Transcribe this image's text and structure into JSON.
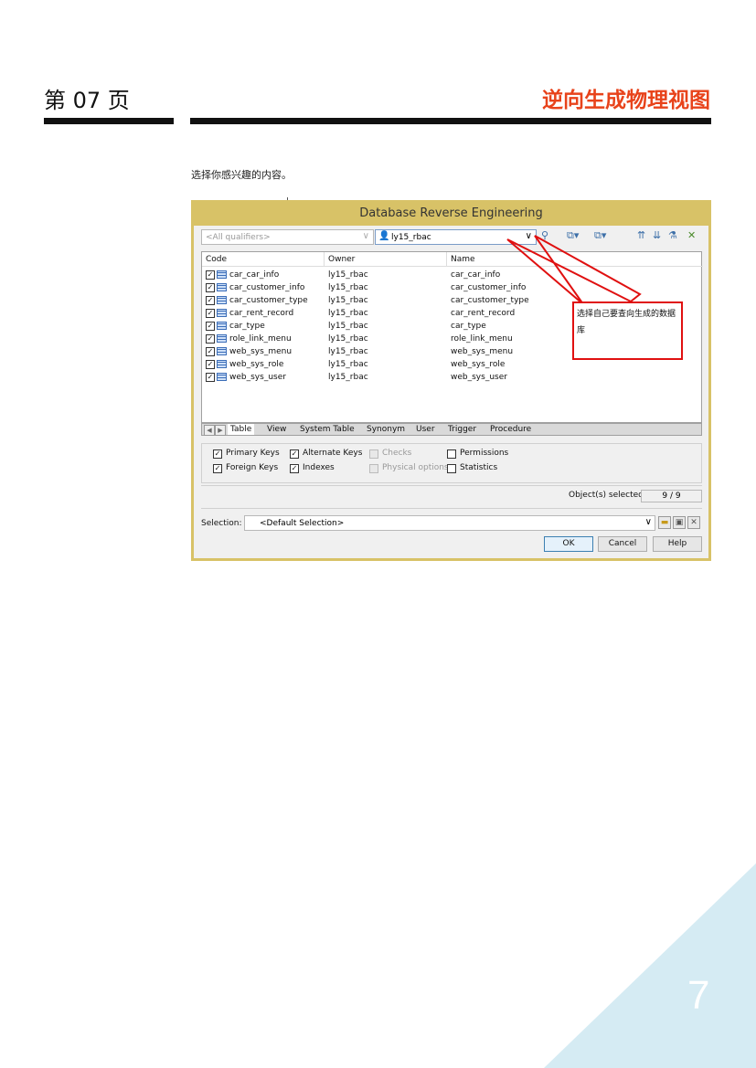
{
  "header": {
    "page_label": "第 07 页",
    "chapter_title": "逆向生成物理视图"
  },
  "intro_text": "选择你感兴趣的内容。",
  "dialog": {
    "title": "Database Reverse Engineering",
    "qualifier_placeholder": "<All qualifiers>",
    "database": "ly15_rbac",
    "columns": [
      "Code",
      "Owner",
      "Name"
    ],
    "rows": [
      {
        "code": "car_car_info",
        "owner": "ly15_rbac",
        "name": "car_car_info",
        "checked": true
      },
      {
        "code": "car_customer_info",
        "owner": "ly15_rbac",
        "name": "car_customer_info",
        "checked": true
      },
      {
        "code": "car_customer_type",
        "owner": "ly15_rbac",
        "name": "car_customer_type",
        "checked": true
      },
      {
        "code": "car_rent_record",
        "owner": "ly15_rbac",
        "name": "car_rent_record",
        "checked": true
      },
      {
        "code": "car_type",
        "owner": "ly15_rbac",
        "name": "car_type",
        "checked": true
      },
      {
        "code": "role_link_menu",
        "owner": "ly15_rbac",
        "name": "role_link_menu",
        "checked": true
      },
      {
        "code": "web_sys_menu",
        "owner": "ly15_rbac",
        "name": "web_sys_menu",
        "checked": true
      },
      {
        "code": "web_sys_role",
        "owner": "ly15_rbac",
        "name": "web_sys_role",
        "checked": true
      },
      {
        "code": "web_sys_user",
        "owner": "ly15_rbac",
        "name": "web_sys_user",
        "checked": true
      }
    ],
    "tabs": [
      "Table",
      "View",
      "System Table",
      "Synonym",
      "User",
      "Trigger",
      "Procedure"
    ],
    "options": {
      "primary_keys": "Primary Keys",
      "foreign_keys": "Foreign Keys",
      "alternate_keys": "Alternate Keys",
      "indexes": "Indexes",
      "checks": "Checks",
      "physical_options": "Physical options",
      "permissions": "Permissions",
      "statistics": "Statistics"
    },
    "objects_selected_label": "Object(s) selected:",
    "objects_selected_value": "9 / 9",
    "selection_label": "Selection:",
    "selection_value": "<Default Selection>",
    "ok_label": "OK",
    "cancel_label": "Cancel",
    "help_label": "Help"
  },
  "annotation": "选择自己要查向生成的数据库",
  "page_number": "7",
  "colors": {
    "accent": "#e8431b",
    "dialog_frame": "#d8c267",
    "annotation_red": "#e01010",
    "corner": "#d5ebf3"
  }
}
